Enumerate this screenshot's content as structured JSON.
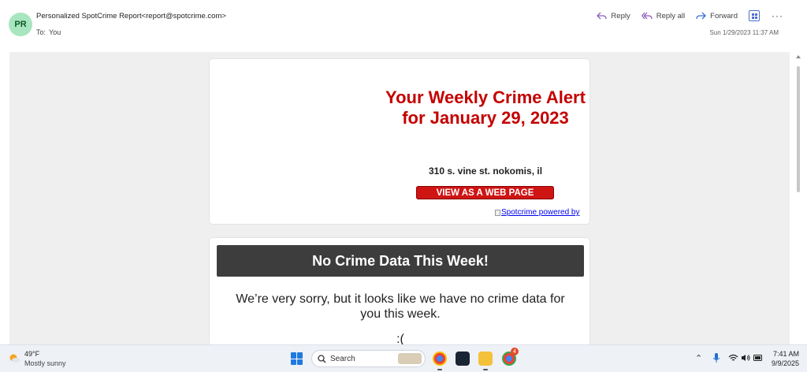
{
  "header": {
    "avatar_initials": "PR",
    "sender": "Personalized SpotCrime Report<report@spotcrime.com>",
    "to_label": "To:",
    "to_value": "You",
    "reply_label": "Reply",
    "reply_all_label": "Reply all",
    "forward_label": "Forward",
    "more_label": "···",
    "date": "Sun 1/29/2023 11:37 AM"
  },
  "email": {
    "title": "Your Weekly Crime Alert for January 29, 2023",
    "address": "310 s. vine st. nokomis, il",
    "web_button": "VIEW AS A WEB PAGE",
    "powered_by": "Spotcrime powered by",
    "no_data_banner": "No Crime Data This Week!",
    "sorry_text": "We’re very sorry, but it looks like we have no crime data for you this week.",
    "frown": ":("
  },
  "taskbar": {
    "temperature": "49°F",
    "condition": "Mostly sunny",
    "search_label": "Search",
    "time": "7:41 AM",
    "date": "9/9/2025",
    "notification_badge": "4"
  },
  "colors": {
    "alert_red": "#c40000",
    "button_red": "#cf1414",
    "banner_dark": "#3d3d3d",
    "body_bg": "#efefef"
  }
}
